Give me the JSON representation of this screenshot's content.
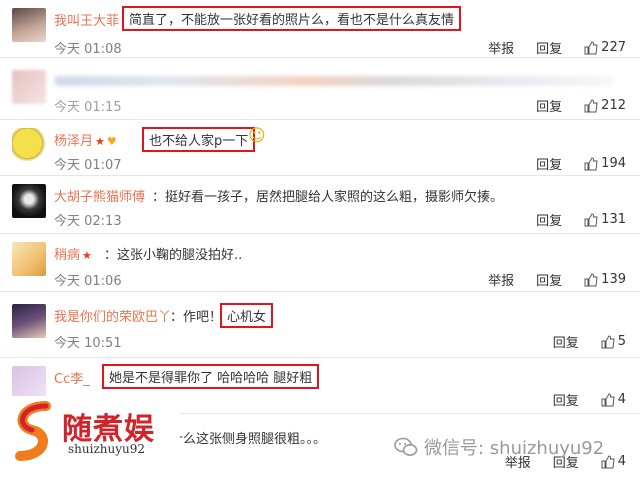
{
  "actions": {
    "report": "举报",
    "reply": "回复"
  },
  "comments": [
    {
      "name": "我叫王大菲",
      "text": "简直了，不能放一张好看的照片么，看也不是什么真友情",
      "time": "今天 01:08",
      "likes": "227"
    },
    {
      "name": "",
      "text": "",
      "time": "今天 01:15",
      "likes": "212"
    },
    {
      "name": "杨泽月",
      "text": "也不给人家p一下",
      "time": "今天 01:07",
      "likes": "194"
    },
    {
      "name": "大胡子熊猫师傅",
      "text": "：挺好看一孩子，居然把腿给人家照的这么粗，摄影师欠揍。",
      "time": "今天 02:13",
      "likes": "131"
    },
    {
      "name": "稍病",
      "text": "：这张小鞠的腿没拍好..",
      "time": "今天 01:06",
      "likes": "139"
    },
    {
      "name": "我是你们的荣欧巴丫",
      "text_prefix": "：作吧！",
      "text": "心机女",
      "time": "今天 10:51",
      "likes": "5"
    },
    {
      "name": "Cc李_",
      "text": "她是不是得罪你了 哈哈哈哈 腿好粗",
      "likes": "4"
    },
    {
      "text": "什么这张侧身照腿很粗。。。",
      "likes": "4"
    }
  ],
  "watermark": {
    "brand": "随煮娱",
    "site": "shuizhuyu92",
    "wechat": "微信号: shuizhuyu92"
  },
  "colors": {
    "name": "#eb7350",
    "highlight": "#e0161e",
    "brand": "#d2232a"
  }
}
